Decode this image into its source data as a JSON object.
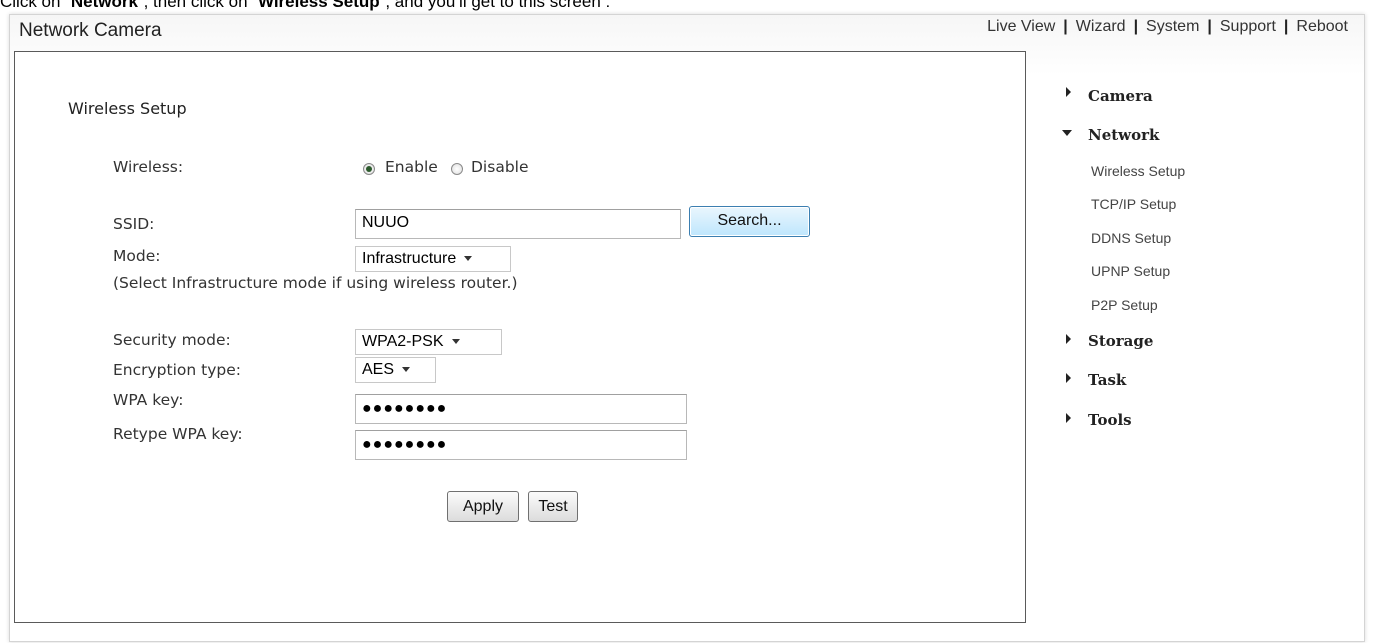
{
  "caption": {
    "prefix": "Click on “",
    "network": "Network",
    "middle": "”, then click on “",
    "wireless": "Wireless Setup",
    "suffix": "”, and you’ll get to this screen :"
  },
  "app": {
    "title": "Network Camera"
  },
  "topnav": {
    "live_view": "Live View",
    "wizard": "Wizard",
    "system": "System",
    "support": "Support",
    "reboot": "Reboot",
    "separator": "|"
  },
  "form": {
    "section_title": "Wireless Setup",
    "wireless_label": "Wireless:",
    "enable_label": "Enable",
    "disable_label": "Disable",
    "wireless_value": "Enable",
    "ssid_label": "SSID:",
    "ssid_value": "NUUO",
    "search_button": "Search...",
    "mode_label": "Mode:",
    "mode_value": "Infrastructure",
    "mode_hint": "(Select Infrastructure mode if using wireless router.)",
    "security_label": "Security mode:",
    "security_value": "WPA2-PSK",
    "encryption_label": "Encryption type:",
    "encryption_value": "AES",
    "wpa_key_label": "WPA key:",
    "wpa_key_value": "●●●●●●●●",
    "retype_label": "Retype WPA key:",
    "retype_value": "●●●●●●●●",
    "apply_button": "Apply",
    "test_button": "Test"
  },
  "sidebar": {
    "camera": "Camera",
    "network": "Network",
    "network_items": [
      "Wireless Setup",
      "TCP/IP Setup",
      "DDNS Setup",
      "UPNP Setup",
      "P2P Setup"
    ],
    "storage": "Storage",
    "task": "Task",
    "tools": "Tools"
  }
}
